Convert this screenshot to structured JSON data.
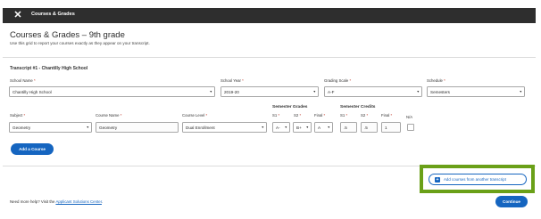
{
  "header": {
    "title": "Courses & Grades",
    "close_glyph": "✕"
  },
  "page": {
    "title": "Courses & Grades – 9th grade",
    "subtitle": "Use this grid to report your courses exactly as they appear on your transcript."
  },
  "transcript": {
    "title": "Transcript #1 - Chantilly High School",
    "school_name": {
      "label": "School Name",
      "value": "Chantilly High School"
    },
    "school_year": {
      "label": "School Year",
      "value": "2019-20"
    },
    "grading_scale": {
      "label": "Grading Scale",
      "value": "A-F"
    },
    "schedule": {
      "label": "Schedule",
      "value": "Semesters"
    }
  },
  "course_grid": {
    "subject_label": "Subject",
    "course_name_label": "Course Name",
    "course_level_label": "Course Level",
    "semester_grades_label": "Semester Grades",
    "semester_credits_label": "Semester Credits",
    "s1_label": "S1",
    "s2_label": "S2",
    "final_label": "Final",
    "na_label": "N/A",
    "required_mark": "*",
    "row": {
      "subject": "Geometry",
      "course_name": "Geometry",
      "course_level": "Dual Enrollment",
      "grade_s1": "A-",
      "grade_s2": "B+",
      "grade_final": "A",
      "credit_s1": ".5",
      "credit_s2": ".5",
      "credit_final": "1",
      "na_checked": false
    }
  },
  "actions": {
    "add_course": "Add a Course",
    "add_from_transcript": "Add courses from another transcript",
    "continue": "Continue"
  },
  "footer": {
    "help_prefix": "Need more help? Visit the",
    "help_link": "Applicant Solutions Center",
    "help_suffix": "."
  },
  "colors": {
    "topbar": "#2e2e2e",
    "primary": "#1565c0",
    "highlight": "#6aa018",
    "required": "#c0392b"
  }
}
